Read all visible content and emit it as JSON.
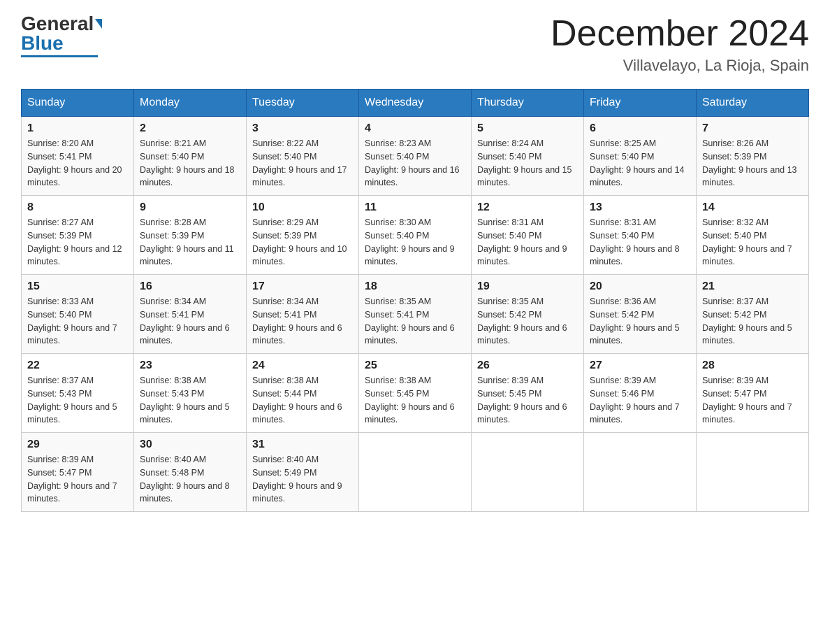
{
  "header": {
    "logo_text_black": "General",
    "logo_text_blue": "Blue",
    "title": "December 2024",
    "subtitle": "Villavelayo, La Rioja, Spain"
  },
  "weekdays": [
    "Sunday",
    "Monday",
    "Tuesday",
    "Wednesday",
    "Thursday",
    "Friday",
    "Saturday"
  ],
  "weeks": [
    [
      {
        "day": "1",
        "sunrise": "8:20 AM",
        "sunset": "5:41 PM",
        "daylight": "9 hours and 20 minutes."
      },
      {
        "day": "2",
        "sunrise": "8:21 AM",
        "sunset": "5:40 PM",
        "daylight": "9 hours and 18 minutes."
      },
      {
        "day": "3",
        "sunrise": "8:22 AM",
        "sunset": "5:40 PM",
        "daylight": "9 hours and 17 minutes."
      },
      {
        "day": "4",
        "sunrise": "8:23 AM",
        "sunset": "5:40 PM",
        "daylight": "9 hours and 16 minutes."
      },
      {
        "day": "5",
        "sunrise": "8:24 AM",
        "sunset": "5:40 PM",
        "daylight": "9 hours and 15 minutes."
      },
      {
        "day": "6",
        "sunrise": "8:25 AM",
        "sunset": "5:40 PM",
        "daylight": "9 hours and 14 minutes."
      },
      {
        "day": "7",
        "sunrise": "8:26 AM",
        "sunset": "5:39 PM",
        "daylight": "9 hours and 13 minutes."
      }
    ],
    [
      {
        "day": "8",
        "sunrise": "8:27 AM",
        "sunset": "5:39 PM",
        "daylight": "9 hours and 12 minutes."
      },
      {
        "day": "9",
        "sunrise": "8:28 AM",
        "sunset": "5:39 PM",
        "daylight": "9 hours and 11 minutes."
      },
      {
        "day": "10",
        "sunrise": "8:29 AM",
        "sunset": "5:39 PM",
        "daylight": "9 hours and 10 minutes."
      },
      {
        "day": "11",
        "sunrise": "8:30 AM",
        "sunset": "5:40 PM",
        "daylight": "9 hours and 9 minutes."
      },
      {
        "day": "12",
        "sunrise": "8:31 AM",
        "sunset": "5:40 PM",
        "daylight": "9 hours and 9 minutes."
      },
      {
        "day": "13",
        "sunrise": "8:31 AM",
        "sunset": "5:40 PM",
        "daylight": "9 hours and 8 minutes."
      },
      {
        "day": "14",
        "sunrise": "8:32 AM",
        "sunset": "5:40 PM",
        "daylight": "9 hours and 7 minutes."
      }
    ],
    [
      {
        "day": "15",
        "sunrise": "8:33 AM",
        "sunset": "5:40 PM",
        "daylight": "9 hours and 7 minutes."
      },
      {
        "day": "16",
        "sunrise": "8:34 AM",
        "sunset": "5:41 PM",
        "daylight": "9 hours and 6 minutes."
      },
      {
        "day": "17",
        "sunrise": "8:34 AM",
        "sunset": "5:41 PM",
        "daylight": "9 hours and 6 minutes."
      },
      {
        "day": "18",
        "sunrise": "8:35 AM",
        "sunset": "5:41 PM",
        "daylight": "9 hours and 6 minutes."
      },
      {
        "day": "19",
        "sunrise": "8:35 AM",
        "sunset": "5:42 PM",
        "daylight": "9 hours and 6 minutes."
      },
      {
        "day": "20",
        "sunrise": "8:36 AM",
        "sunset": "5:42 PM",
        "daylight": "9 hours and 5 minutes."
      },
      {
        "day": "21",
        "sunrise": "8:37 AM",
        "sunset": "5:42 PM",
        "daylight": "9 hours and 5 minutes."
      }
    ],
    [
      {
        "day": "22",
        "sunrise": "8:37 AM",
        "sunset": "5:43 PM",
        "daylight": "9 hours and 5 minutes."
      },
      {
        "day": "23",
        "sunrise": "8:38 AM",
        "sunset": "5:43 PM",
        "daylight": "9 hours and 5 minutes."
      },
      {
        "day": "24",
        "sunrise": "8:38 AM",
        "sunset": "5:44 PM",
        "daylight": "9 hours and 6 minutes."
      },
      {
        "day": "25",
        "sunrise": "8:38 AM",
        "sunset": "5:45 PM",
        "daylight": "9 hours and 6 minutes."
      },
      {
        "day": "26",
        "sunrise": "8:39 AM",
        "sunset": "5:45 PM",
        "daylight": "9 hours and 6 minutes."
      },
      {
        "day": "27",
        "sunrise": "8:39 AM",
        "sunset": "5:46 PM",
        "daylight": "9 hours and 7 minutes."
      },
      {
        "day": "28",
        "sunrise": "8:39 AM",
        "sunset": "5:47 PM",
        "daylight": "9 hours and 7 minutes."
      }
    ],
    [
      {
        "day": "29",
        "sunrise": "8:39 AM",
        "sunset": "5:47 PM",
        "daylight": "9 hours and 7 minutes."
      },
      {
        "day": "30",
        "sunrise": "8:40 AM",
        "sunset": "5:48 PM",
        "daylight": "9 hours and 8 minutes."
      },
      {
        "day": "31",
        "sunrise": "8:40 AM",
        "sunset": "5:49 PM",
        "daylight": "9 hours and 9 minutes."
      },
      null,
      null,
      null,
      null
    ]
  ]
}
